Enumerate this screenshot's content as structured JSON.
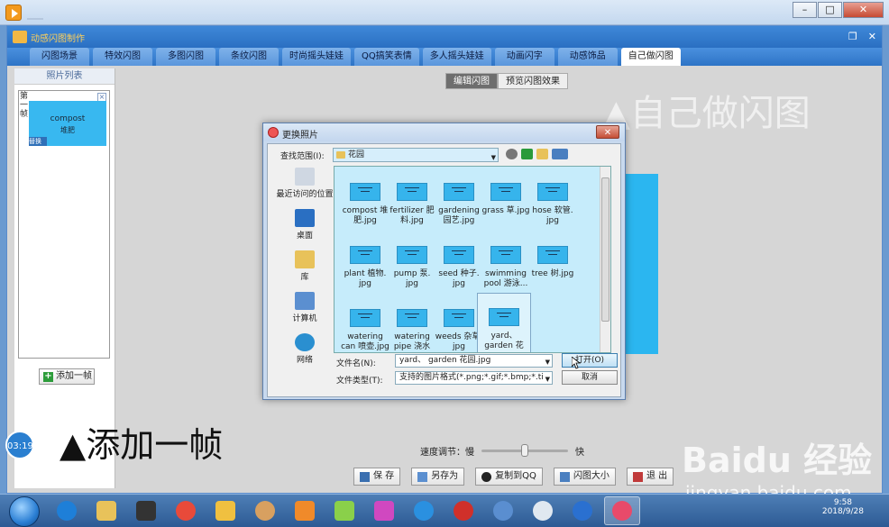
{
  "app": {
    "title": "动感闪图制作",
    "tabs": [
      "闪图场景",
      "特效闪图",
      "多图闪图",
      "条纹闪图",
      "时尚摇头娃娃",
      "QQ搞笑表情",
      "多人摇头娃娃",
      "动画闪字",
      "动感饰品",
      "自己做闪图"
    ],
    "active_tab": "自己做闪图"
  },
  "left_panel": {
    "header": "照片列表",
    "frame_label": "第一帧",
    "thumb_en": "compost",
    "thumb_cn": "堆肥",
    "thumb_badge": "替换",
    "add_frame": "添加一帧"
  },
  "mode_tabs": [
    "编辑闪图",
    "预览闪图效果"
  ],
  "captions": {
    "right": "▲自己做闪图",
    "left": "▲添加一帧"
  },
  "speed": {
    "label": "速度调节：",
    "slow": "慢",
    "fast": "快",
    "level": 0.5
  },
  "bottom_buttons": [
    "保 存",
    "另存为",
    "复制到QQ",
    "闪图大小",
    "退 出"
  ],
  "clock_bubble": "03:19",
  "dialog": {
    "title": "更换照片",
    "lookin_label": "查找范围(I):",
    "lookin_value": "花园",
    "places": [
      "最近访问的位置",
      "桌面",
      "库",
      "计算机",
      "网络"
    ],
    "files": [
      {
        "name": "compost 堆肥.jpg",
        "l1": "compost 堆",
        "l2": "肥.jpg"
      },
      {
        "name": "fertilizer 肥料.jpg",
        "l1": "fertilizer 肥",
        "l2": "料.jpg"
      },
      {
        "name": "gardening 园艺.jpg",
        "l1": "gardening",
        "l2": "园艺.jpg"
      },
      {
        "name": "grass 草.jpg",
        "l1": "grass 草.jpg",
        "l2": ""
      },
      {
        "name": "hose 软管.jpg",
        "l1": "hose 软管.",
        "l2": "jpg"
      },
      {
        "name": "plant 植物.jpg",
        "l1": "plant 植物.",
        "l2": "jpg"
      },
      {
        "name": "pump 泵.jpg",
        "l1": "pump 泵.",
        "l2": "jpg"
      },
      {
        "name": "seed 种子.jpg",
        "l1": "seed 种子.",
        "l2": "jpg"
      },
      {
        "name": "swimming pool 游泳池",
        "l1": "swimming",
        "l2": "pool 游泳..."
      },
      {
        "name": "tree 树.jpg",
        "l1": "tree 树.jpg",
        "l2": ""
      },
      {
        "name": "watering can 喷壶.jpg",
        "l1": "watering",
        "l2": "can 喷壶.jpg"
      },
      {
        "name": "watering pipe 浇水管",
        "l1": "watering",
        "l2": "pipe 浇水"
      },
      {
        "name": "weeds 杂草.jpg",
        "l1": "weeds 杂草.",
        "l2": "jpg"
      },
      {
        "name": "yard、garden 花园.jpg",
        "l1": "yard、",
        "l2": "garden 花"
      }
    ],
    "filename_label": "文件名(N):",
    "filename_value": "yard、 garden 花园.jpg",
    "filetype_label": "文件类型(T):",
    "filetype_value": "支持的图片格式(*.png;*.gif;*.bmp;*.ti",
    "open_label": "打开(O)",
    "cancel_label": "取消"
  },
  "taskbar": {
    "time": "9:58",
    "date": "2018/9/28"
  },
  "watermark": {
    "brand": "Baidu 经验",
    "url": "jingyan.baidu.com"
  }
}
